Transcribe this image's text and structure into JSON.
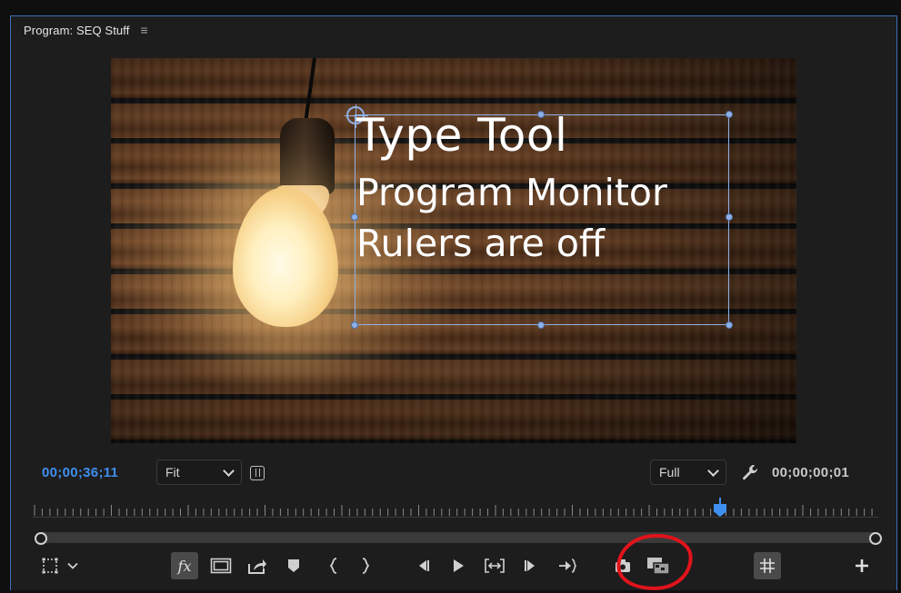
{
  "panel": {
    "title": "Program: SEQ Stuff",
    "menu_icon": "hamburger-icon"
  },
  "video": {
    "title_lines": [
      "Type Tool",
      "Program Monitor",
      "Rulers are off"
    ]
  },
  "controls": {
    "current_timecode": "00;00;36;11",
    "zoom_select": {
      "value": "Fit"
    },
    "resolution_select": {
      "value": "Full"
    },
    "duration_timecode": "00;00;00;01",
    "playhead_position": 0.81
  },
  "transport": {
    "buttons": [
      "safe-margins-icon",
      "chevron-down-icon",
      "fx-icon",
      "safe-frame-icon",
      "export-frame-icon",
      "marker-icon",
      "mark-in-icon",
      "mark-out-icon",
      "step-back-icon",
      "play-icon",
      "go-to-in-out-icon",
      "step-forward-icon",
      "go-to-out-icon",
      "camera-icon",
      "comparison-view-icon",
      "ruler-grid-icon",
      "add-button-icon"
    ],
    "fx_label": "fx"
  },
  "colors": {
    "accent": "#3f8ff0",
    "annotation": "#e1131b",
    "panel_bg": "#1d1d1d"
  }
}
